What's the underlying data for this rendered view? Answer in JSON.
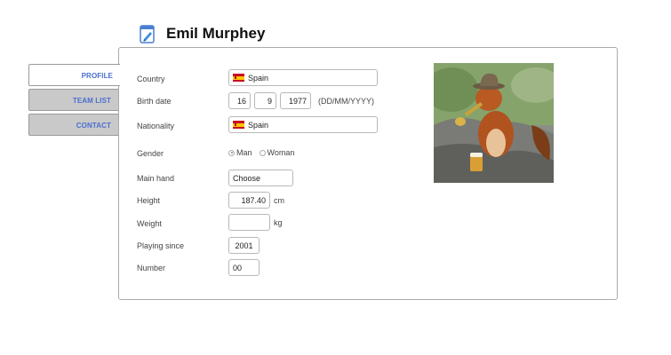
{
  "header": {
    "title": "Emil Murphey",
    "icon": "edit-document-icon"
  },
  "tabs": [
    {
      "label": "PROFILE",
      "active": true
    },
    {
      "label": "TEAM LIST",
      "active": false
    },
    {
      "label": "CONTACT",
      "active": false
    }
  ],
  "form": {
    "country": {
      "label": "Country",
      "value": "Spain"
    },
    "birth_date": {
      "label": "Birth date",
      "day": "16",
      "month": "9",
      "year": "1977",
      "format": "(DD/MM/YYYY)"
    },
    "nationality": {
      "label": "Nationality",
      "value": "Spain"
    },
    "gender": {
      "label": "Gender",
      "options": [
        "Man",
        "Woman"
      ],
      "selected": "Man"
    },
    "main_hand": {
      "label": "Main hand",
      "value": "Choose"
    },
    "height": {
      "label": "Height",
      "value": "187.40",
      "unit": "cm"
    },
    "weight": {
      "label": "Weight",
      "value": "",
      "unit": "kg"
    },
    "playing_since": {
      "label": "Playing since",
      "value": "2001"
    },
    "number": {
      "label": "Number",
      "value": "00"
    }
  },
  "colors": {
    "tab_text": "#4a6fd0",
    "tab_bg": "#c9c9c9",
    "flag_red": "#c60b1e",
    "flag_yellow": "#ffc400"
  }
}
